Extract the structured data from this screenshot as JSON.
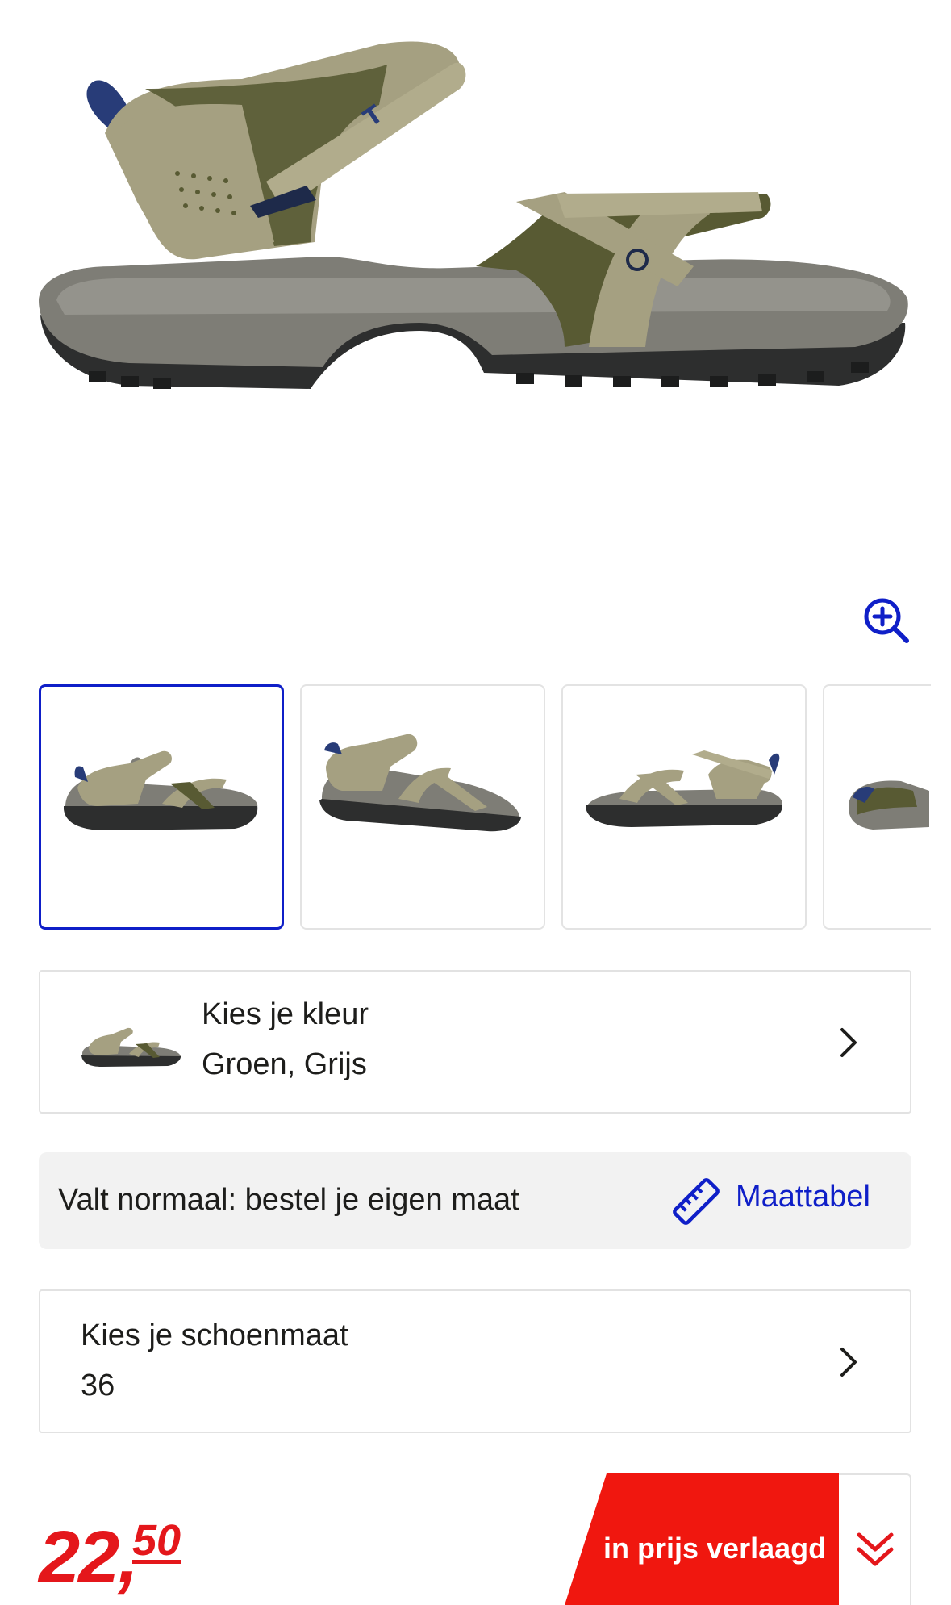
{
  "product": {
    "main_image": "teva-sandal-green-grey-side-view",
    "colors": {
      "strap": "#a5a081",
      "strap_dark": "#585a33",
      "sole": "#7e7d76",
      "outsole": "#2d2e2e",
      "heel_loop": "#283c78"
    }
  },
  "gallery": {
    "zoom_icon": "zoom-in-icon",
    "thumbnails": [
      {
        "view": "side",
        "selected": true
      },
      {
        "view": "three-quarter",
        "selected": false
      },
      {
        "view": "inner-side",
        "selected": false
      },
      {
        "view": "sole-detail",
        "selected": false
      }
    ]
  },
  "color_selector": {
    "label": "Kies je kleur",
    "value": "Groen, Grijs"
  },
  "fit": {
    "text": "Valt normaal: bestel je eigen maat",
    "size_chart_link": "Maattabel",
    "icon": "ruler-icon"
  },
  "size_selector": {
    "label": "Kies je schoenmaat",
    "value": "36"
  },
  "price": {
    "whole": "22,",
    "cents": "50"
  },
  "promo": {
    "label": "in prijs verlaagd",
    "icon": "double-chevron-down-icon"
  },
  "theme": {
    "accent": "#0f1fc8",
    "sale": "#e4171b",
    "promo_bg": "#f0170f"
  }
}
